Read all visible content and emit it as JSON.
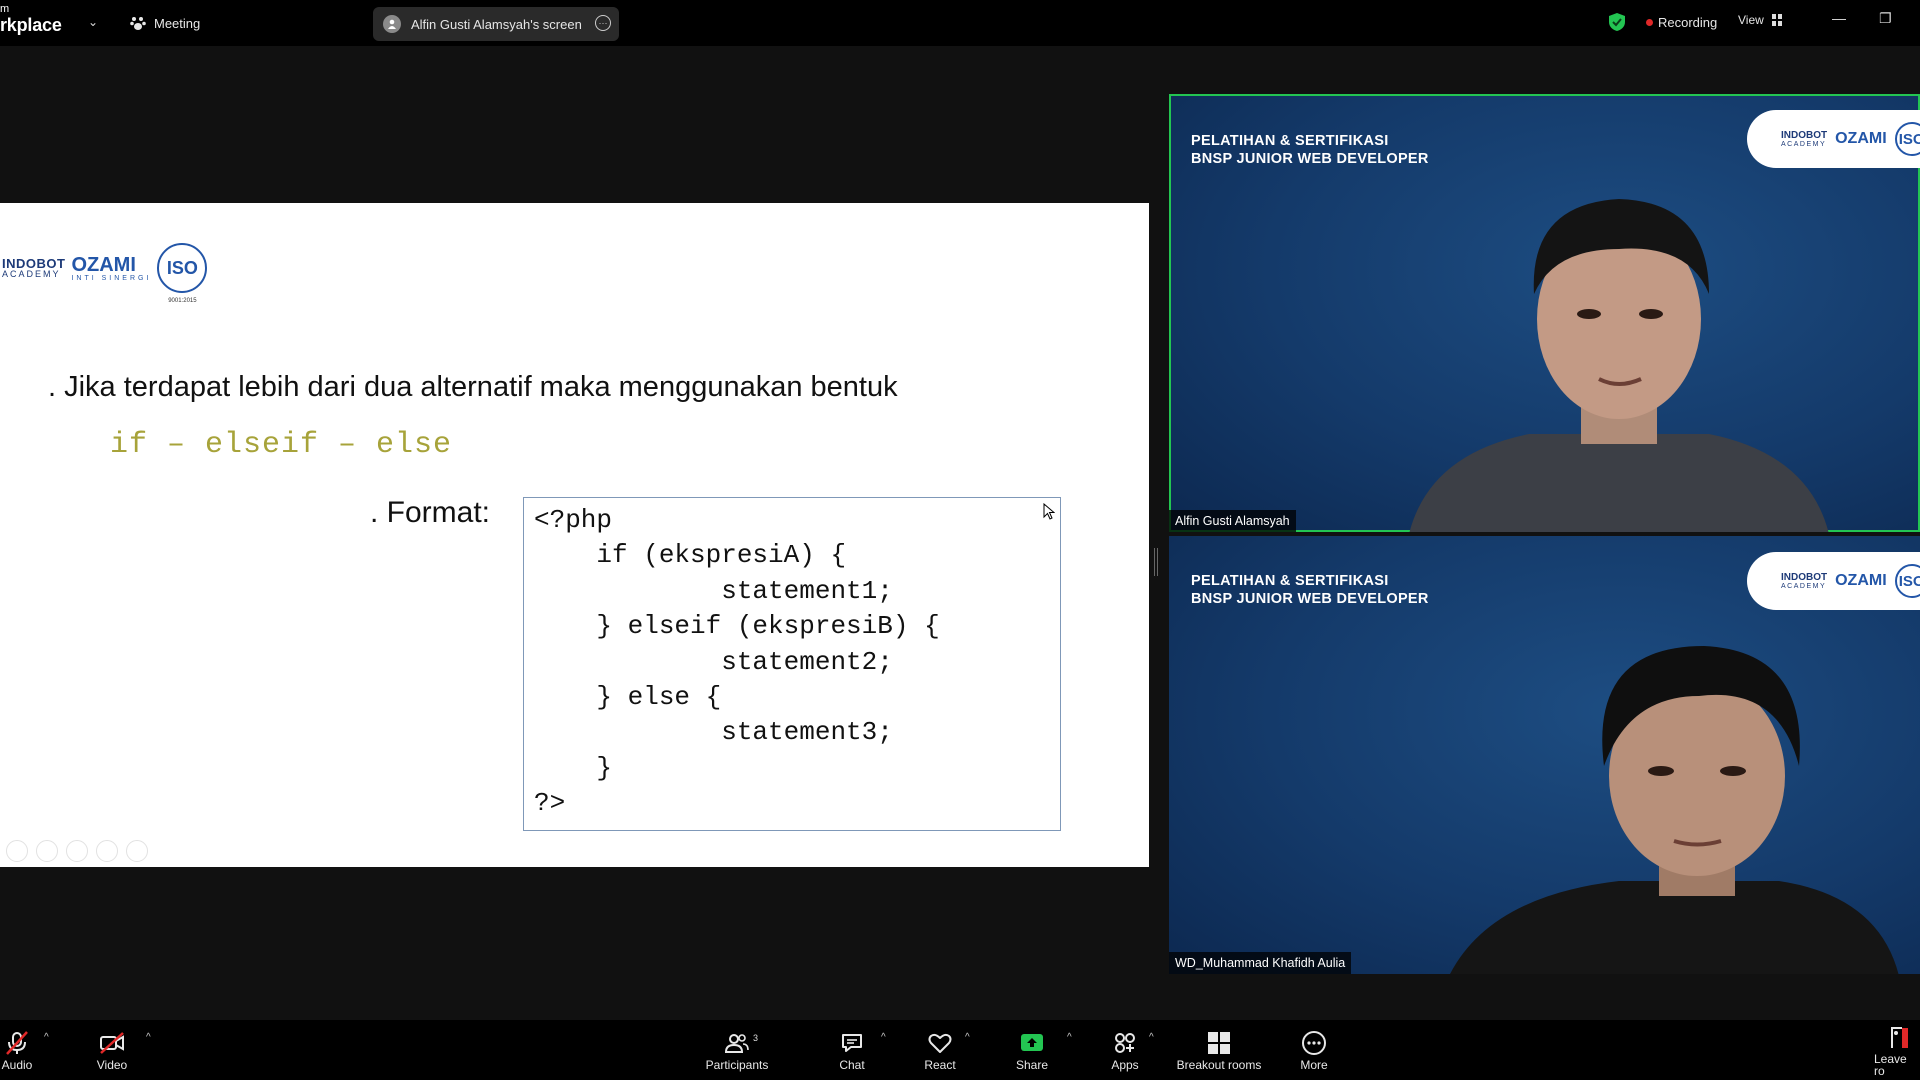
{
  "topbar": {
    "brand_top": "m",
    "brand_main": "rkplace",
    "meeting_label": "Meeting",
    "screen_share_label": "Alfin Gusti Alamsyah's screen",
    "recording_label": "Recording",
    "view_label": "View",
    "minimize_glyph": "—",
    "restore_glyph": "❐"
  },
  "slide": {
    "logo_indobot": "INDOBOT",
    "logo_indobot_sub": "ACADEMY",
    "logo_ozami": "OZAMI",
    "logo_ozami_sub": "INTI SINERGI",
    "logo_iso": "ISO",
    "logo_iso_sub": "9001:2015",
    "bullet": ". Jika terdapat lebih dari dua alternatif maka menggunakan bentuk",
    "syntax": "if – elseif – else",
    "format_label": ". Format:",
    "code": "<?php\n    if (ekspresiA) {\n            statement1;\n    } elseif (ekspresiB) {\n            statement2;\n    } else {\n            statement3;\n    }\n?>"
  },
  "tiles": [
    {
      "title_line1": "PELATIHAN & SERTIFIKASI",
      "title_line2": "BNSP JUNIOR WEB DEVELOPER",
      "name": "Alfin Gusti Alamsyah",
      "active": true
    },
    {
      "title_line1": "PELATIHAN & SERTIFIKASI",
      "title_line2": "BNSP JUNIOR WEB DEVELOPER",
      "name": "WD_Muhammad Khafidh Aulia",
      "active": false
    }
  ],
  "toolbar": {
    "audio": "Audio",
    "video": "Video",
    "participants": "Participants",
    "participants_count": "3",
    "chat": "Chat",
    "react": "React",
    "share": "Share",
    "apps": "Apps",
    "breakout": "Breakout rooms",
    "more": "More",
    "leave": "Leave ro"
  },
  "colors": {
    "accent_green": "#23c552",
    "recording_red": "#e02828",
    "syntax_olive": "#a7a33a",
    "tile_blue": "#143a6a"
  }
}
